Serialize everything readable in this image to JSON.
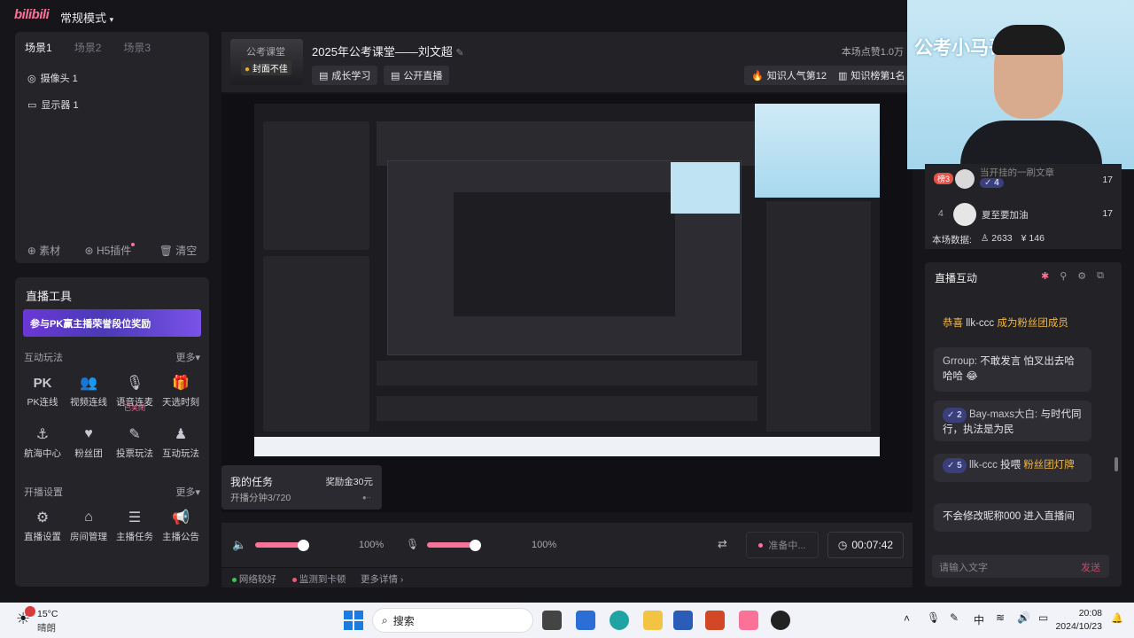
{
  "app": {
    "logo": "bilibili",
    "mode": "常规模式"
  },
  "scenes": {
    "tabs": [
      "场景1",
      "场景2",
      "场景3"
    ],
    "sources": [
      "摄像头 1",
      "显示器 1"
    ],
    "footer": [
      "素材",
      "H5插件",
      "清空"
    ]
  },
  "tools": {
    "title": "直播工具",
    "banner": "参与PK赢主播荣誉段位奖励",
    "interactive_section": "互动玩法",
    "more": "更多",
    "row1": [
      "PK连线",
      "视频连线",
      "语音连麦",
      "天选时刻"
    ],
    "row1_tag": "已关闭",
    "row2": [
      "航海中心",
      "粉丝团",
      "投票玩法",
      "互动玩法"
    ],
    "settings_section": "开播设置",
    "row3": [
      "直播设置",
      "房间管理",
      "主播任务",
      "主播公告"
    ]
  },
  "header": {
    "cover_label": "公考课堂",
    "cover_badge": "封面不佳",
    "title": "2025年公考课堂——刘文超",
    "views": "本场点赞1.0万",
    "chips": [
      "成长学习",
      "公开直播"
    ],
    "rank1": "知识人气第12",
    "rank2": "知识榜第1名"
  },
  "task": {
    "title": "我的任务",
    "reward": "奖励金30元",
    "progress": "开播分钟3/720"
  },
  "controls": {
    "speaker_pct": "100%",
    "mic_pct": "100%",
    "prepare": "准备中...",
    "timer": "00:07:42"
  },
  "status": {
    "network": "网络较好",
    "monitor": "监测到卡顿",
    "details": "更多详情"
  },
  "camera": {
    "caption": "公考小马哥"
  },
  "ranking": {
    "rows": [
      {
        "rank": "榜3",
        "name": "当开挂的一刷文章",
        "level": "4",
        "score": "17"
      },
      {
        "rank": "4",
        "name": "夏至要加油",
        "score": "17"
      }
    ],
    "stats_label": "本场数据:",
    "viewers": "2633",
    "coins": "146"
  },
  "chat": {
    "title": "直播互动",
    "m1_prefix": "恭喜",
    "m1_user": "llk-ccc",
    "m1_text": "成为粉丝团成员",
    "m2_user": "Grroup:",
    "m2_text": "不敢发言 怕叉出去哈哈哈",
    "m3_level": "2",
    "m3_user": "Bay-maxs大白:",
    "m3_text": "与时代同行，执法是为民",
    "m4_level": "5",
    "m4_user": "llk-ccc",
    "m4_action": "投喂",
    "m4_gift": "粉丝团灯牌",
    "m5_text": "不会修改昵称000 进入直播间",
    "input_placeholder": "请输入文字",
    "send": "发送"
  },
  "taskbar": {
    "weather_temp": "15°C",
    "weather_desc": "晴朗",
    "search": "搜索",
    "time": "20:08",
    "date": "2024/10/23",
    "ime": "中"
  },
  "colors": {
    "accent": "#fb7299",
    "bg": "#16161a",
    "panel": "#242429"
  }
}
